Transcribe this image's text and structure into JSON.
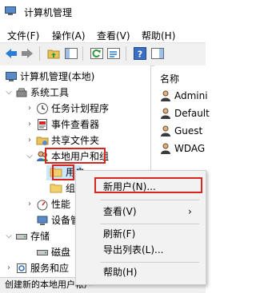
{
  "window": {
    "title": "计算机管理"
  },
  "menu": {
    "items": [
      "文件(F)",
      "操作(A)",
      "查看(V)",
      "帮助(H)"
    ]
  },
  "tree": {
    "root": "计算机管理(本地)",
    "system_tools": "系统工具",
    "task_scheduler": "任务计划程序",
    "event_viewer": "事件查看器",
    "shared_folders": "共享文件夹",
    "local_users_groups": "本地用户和组",
    "users": "用户",
    "groups_partial": "组",
    "performance": "性能",
    "device_manager": "设备管",
    "storage": "存储",
    "disk": "磁盘",
    "services": "服务和应"
  },
  "list": {
    "header": "名称",
    "items": [
      "Admini",
      "Default",
      "Guest",
      "WDAG"
    ]
  },
  "context_menu": {
    "new_user": "新用户(N)...",
    "view": "查看(V)",
    "refresh": "刷新(F)",
    "export": "导出列表(L)...",
    "help": "帮助(H)",
    "submenu_arrow": "›"
  },
  "status": {
    "text": "创建新的本地用户帐户"
  },
  "colors": {
    "highlight_red": "#d9251d",
    "selection": "#cce8ff"
  }
}
